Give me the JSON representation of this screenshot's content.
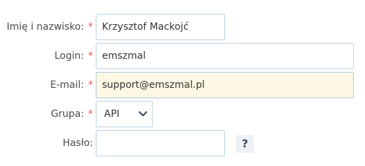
{
  "form": {
    "name": {
      "label": "Imię i nazwisko:",
      "required": "*",
      "value": "Krzysztof Mackojć"
    },
    "login": {
      "label": "Login:",
      "required": "*",
      "value": "emszmal"
    },
    "email": {
      "label": "E-mail:",
      "required": "*",
      "value": "support@emszmal.pl"
    },
    "group": {
      "label": "Grupa:",
      "required": "*",
      "value": "API"
    },
    "password": {
      "label": "Hasło:",
      "value": "",
      "help": "?"
    }
  },
  "colors": {
    "required": "#e05a5a",
    "focus_bg": "#fdf8e3",
    "border": "#b9d3e4"
  },
  "icons": {
    "select_arrow": "chevron-down-icon",
    "help": "help-icon"
  }
}
